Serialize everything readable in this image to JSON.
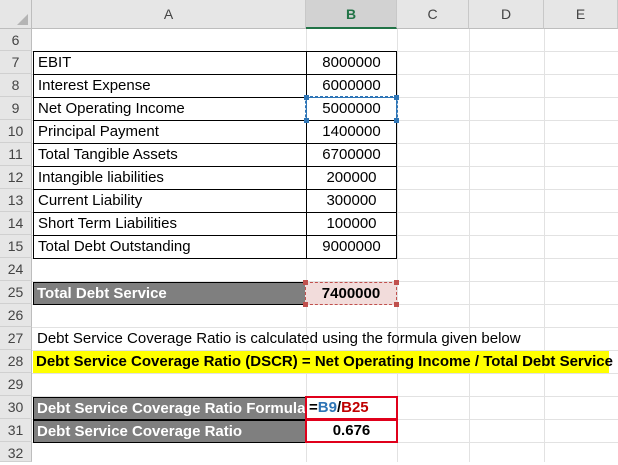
{
  "columns": [
    "A",
    "B",
    "C",
    "D",
    "E"
  ],
  "rows": {
    "r6": "6",
    "r7": "7",
    "r8": "8",
    "r9": "9",
    "r10": "10",
    "r11": "11",
    "r12": "12",
    "r13": "13",
    "r14": "14",
    "r15": "15",
    "r24": "24",
    "r25": "25",
    "r26": "26",
    "r27": "27",
    "r28": "28",
    "r29": "29",
    "r30": "30",
    "r31": "31",
    "r32": "32"
  },
  "inputs": [
    {
      "label": "EBIT",
      "value": "8000000"
    },
    {
      "label": "Interest Expense",
      "value": "6000000"
    },
    {
      "label": "Net Operating  Income",
      "value": "5000000"
    },
    {
      "label": "Principal Payment",
      "value": "1400000"
    },
    {
      "label": "Total Tangible Assets",
      "value": "6700000"
    },
    {
      "label": "Intangible liabilities",
      "value": "200000"
    },
    {
      "label": "Current Liability",
      "value": "300000"
    },
    {
      "label": "Short Term Liabilities",
      "value": "100000"
    },
    {
      "label": "Total Debt Outstanding",
      "value": "9000000"
    }
  ],
  "total_debt_service": {
    "label": "Total Debt Service",
    "value": "7400000"
  },
  "note": "Debt Service Coverage Ratio is calculated using the formula given below",
  "formula_text": "Debt Service Coverage Ratio (DSCR) = Net Operating Income / Total Debt Service",
  "formula_row": {
    "label": "Debt Service Coverage Ratio Formula",
    "eq": "=",
    "ref1": "B9",
    "slash": "/",
    "ref2": "B25"
  },
  "result_row": {
    "label": "Debt Service Coverage Ratio",
    "value": "0.676"
  },
  "colors": {
    "accent_green": "#217346",
    "ref_blue": "#2e75b6",
    "ref_red": "#c00000",
    "highlight": "#ffff00",
    "dark_fill": "#7f7f7f"
  }
}
